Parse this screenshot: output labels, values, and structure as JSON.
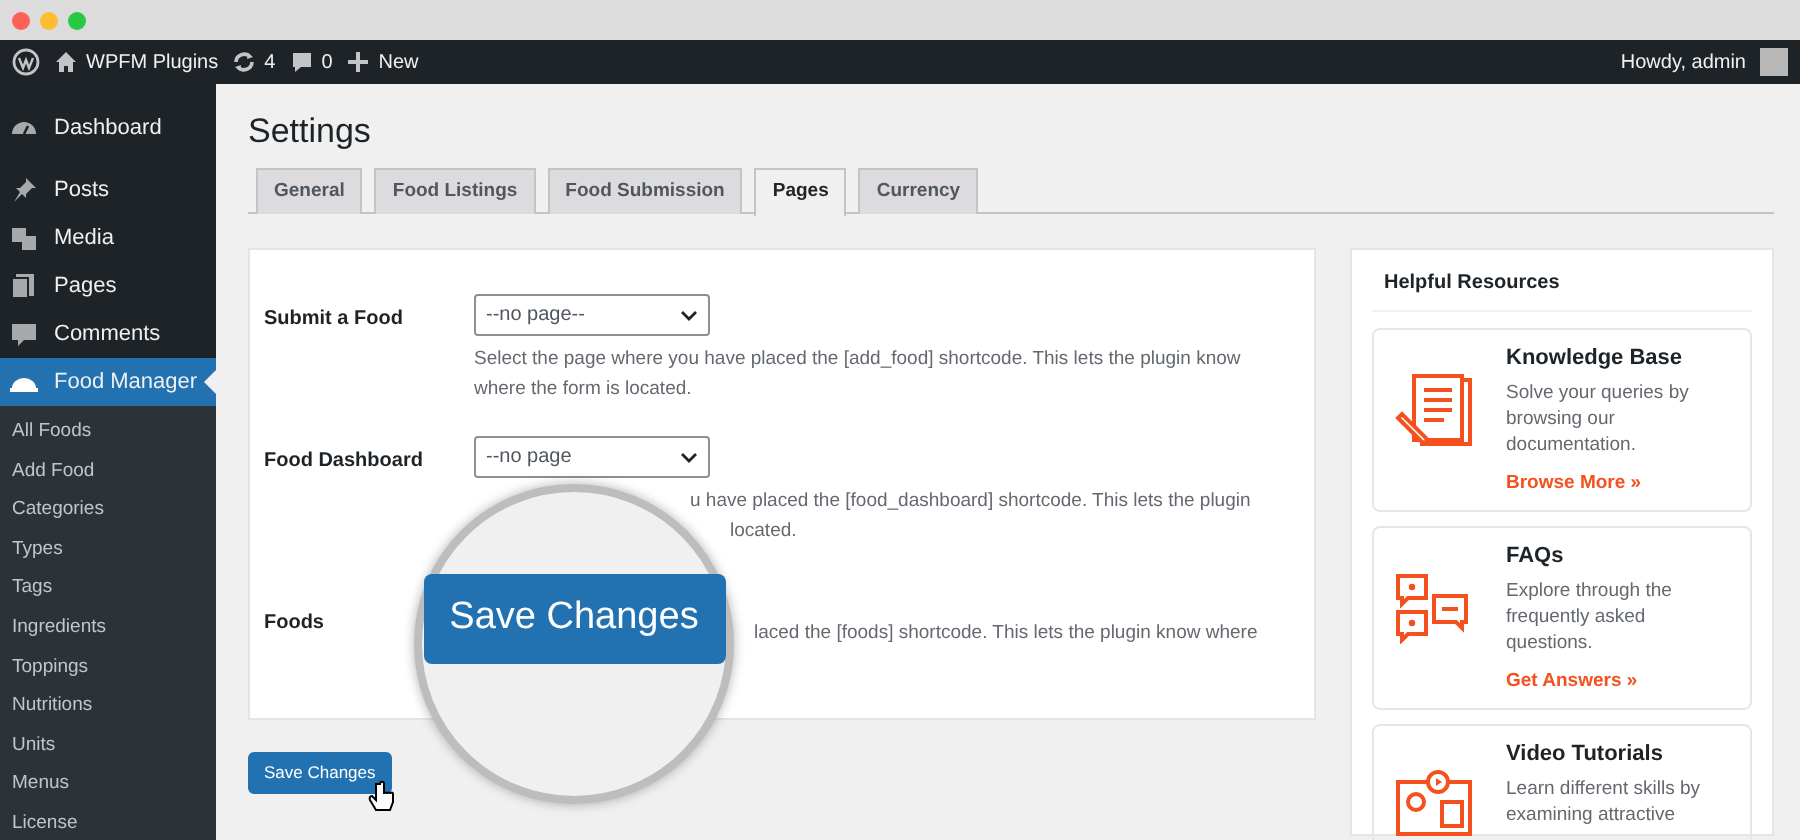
{
  "admin_bar": {
    "site": "WPFM Plugins",
    "updates": "4",
    "comments": "0",
    "new": "New",
    "greeting": "Howdy, admin"
  },
  "sidebar": {
    "items": [
      {
        "label": "Dashboard",
        "selected": false
      },
      {
        "label": "Posts",
        "selected": false
      },
      {
        "label": "Media",
        "selected": false
      },
      {
        "label": "Pages",
        "selected": false
      },
      {
        "label": "Comments",
        "selected": false
      },
      {
        "label": "Food Manager",
        "selected": true,
        "children": [
          "All Foods",
          "Add Food",
          "Categories",
          "Types",
          "Tags",
          "Ingredients",
          "Toppings",
          "Nutritions",
          "Units",
          "Menus",
          "License"
        ]
      }
    ]
  },
  "page_title": "Settings",
  "tabs": [
    {
      "label": "General",
      "selected": false
    },
    {
      "label": "Food Listings",
      "selected": false
    },
    {
      "label": "Food Submission",
      "selected": false
    },
    {
      "label": "Pages",
      "selected": true
    },
    {
      "label": "Currency",
      "selected": false
    }
  ],
  "fields": [
    {
      "label": "Submit a Food",
      "select": "--no page--",
      "description": [
        "Select the page where you have placed the [add_food] shortcode. This lets the plugin know",
        "where the form is located."
      ]
    },
    {
      "label": "Food Dashboard",
      "select": "--no page",
      "description": [
        "u have placed the [food_dashboard] shortcode. This lets the plugin",
        "located."
      ]
    },
    {
      "label": "Foods",
      "description": [
        "laced the [foods] shortcode. This lets the plugin know where"
      ]
    }
  ],
  "save_button": "Save Changes",
  "magnifier": {
    "button": "Save Changes"
  },
  "resources": {
    "title": "Helpful Resources",
    "items": [
      {
        "title": "Knowledge Base",
        "text": "Solve your queries by browsing our documentation.",
        "link": "Browse More »"
      },
      {
        "title": "FAQs",
        "text": "Explore through the frequently asked questions.",
        "link": "Get Answers »"
      },
      {
        "title": "Video Tutorials",
        "text": "Learn different skills by examining attractive"
      }
    ]
  }
}
